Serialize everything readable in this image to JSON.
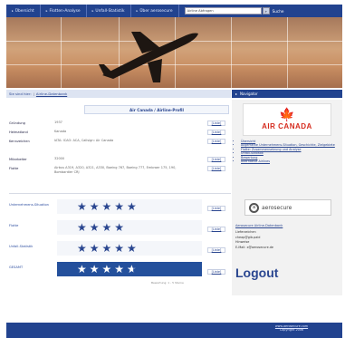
{
  "nav": {
    "items": [
      "Übersicht",
      "Flotten-Analyse",
      "Unfall-Statistik",
      "Über aerosecure"
    ],
    "search_value": "Airline Abfragen",
    "search_label": "Suche"
  },
  "breadcrumb": {
    "root": "Sie sind hier:",
    "current": "Airline-Datenbank"
  },
  "navigator_title": "Navigator",
  "panel": {
    "title": "Air Canada / Airline-Profil",
    "edit_label": "[Liste]",
    "rows": [
      {
        "label": "Gründung",
        "value": "1937"
      },
      {
        "label": "Heimatland",
        "value": "Kanada"
      },
      {
        "label": "Kennzeichen",
        "value": "IATA: ",
        "value2": "ICAO:  ACA, Callsign: Air Canada"
      },
      {
        "label": "Mitarbeiter",
        "value": "32000"
      },
      {
        "label": "Flotte",
        "value": "Airbus A319, A320, A321, A330, Boeing 767, Boeing 777, Embraer 175, 190, Bombardier CRJ"
      }
    ],
    "ratings": [
      {
        "label": "Unternehmens-Situation",
        "stars": 5
      },
      {
        "label": "Flotte",
        "stars": 4
      },
      {
        "label": "Unfall-Statistik",
        "stars": 5
      },
      {
        "label": "GESAMT",
        "stars": 4.5
      }
    ],
    "footnote": "Bewertung: 1 - 5 Sterne"
  },
  "sidebar": {
    "logo_text": "AIR CANADA",
    "links": [
      "Übersicht",
      "Allgemeine Unternehmens-Situation, Geschichte, Zielgebiete",
      "Flotte: Zusammensetzung und Analyse",
      "Unfall-Statistik",
      "Bewertung",
      "alternative Airlines"
    ],
    "partner_name": "aerosecure",
    "user_title": "Aerosecure Airline-Datenbank",
    "user_lines": [
      "Lieferzeichen",
      "cheap@gib.paid",
      "Hinweise",
      "E-Mail: x@aerosecure.de"
    ],
    "logout_label": "Logout"
  },
  "footer": {
    "line1": "www.aerosecure.com",
    "line2": "Copyright 2006"
  },
  "colors": {
    "nav_blue": "#22438f",
    "accent_red": "#d52b1e",
    "link_blue": "#2a4690"
  }
}
